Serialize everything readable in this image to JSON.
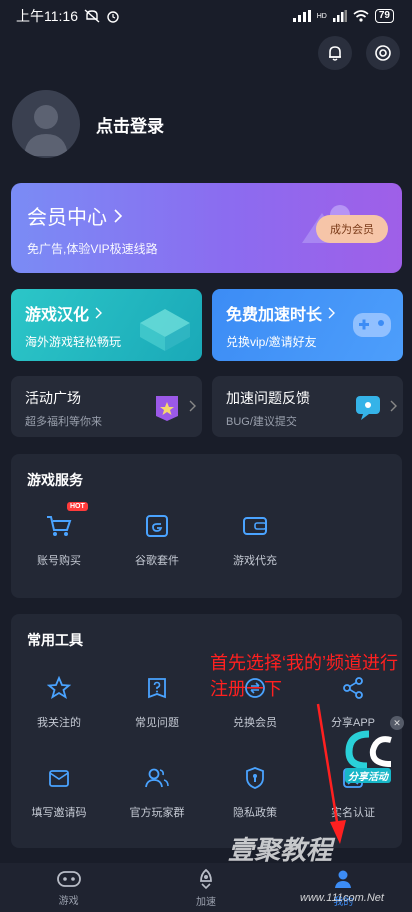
{
  "status": {
    "time": "上午11:16",
    "signal_label": "HD",
    "battery": "79"
  },
  "profile": {
    "login": "点击登录"
  },
  "vip": {
    "title": "会员中心",
    "subtitle": "免广告,体验VIP极速线路",
    "button": "成为会员"
  },
  "promo": [
    {
      "title": "游戏汉化",
      "subtitle": "海外游戏轻松畅玩"
    },
    {
      "title": "免费加速时长",
      "subtitle": "兑换vip/邀请好友"
    }
  ],
  "small_cards": [
    {
      "title": "活动广场",
      "subtitle": "超多福利等你来"
    },
    {
      "title": "加速问题反馈",
      "subtitle": "BUG/建议提交"
    }
  ],
  "game_services": {
    "title": "游戏服务",
    "hot_badge": "HOT",
    "items": [
      {
        "label": "账号购买",
        "icon": "cart-icon"
      },
      {
        "label": "谷歌套件",
        "icon": "google-suite-icon"
      },
      {
        "label": "游戏代充",
        "icon": "wallet-icon"
      }
    ]
  },
  "tools": {
    "title": "常用工具",
    "items": [
      {
        "label": "我关注的",
        "icon": "star-icon"
      },
      {
        "label": "常见问题",
        "icon": "question-icon"
      },
      {
        "label": "兑换会员",
        "icon": "exchange-icon"
      },
      {
        "label": "分享APP",
        "icon": "share-icon"
      },
      {
        "label": "填写邀请码",
        "icon": "invite-icon"
      },
      {
        "label": "官方玩家群",
        "icon": "group-icon"
      },
      {
        "label": "隐私政策",
        "icon": "privacy-icon"
      },
      {
        "label": "实名认证",
        "icon": "id-icon"
      }
    ]
  },
  "annotation": "首先选择‘我的’频道进行注册一下",
  "share_badge": "分享活动",
  "nav": [
    {
      "label": "游戏",
      "icon": "gamepad-icon"
    },
    {
      "label": "加速",
      "icon": "rocket-icon"
    },
    {
      "label": "我的",
      "icon": "user-icon"
    }
  ],
  "watermark": {
    "main": "壹聚教程",
    "url": "www.111com.Net"
  },
  "colors": {
    "background": "#191d29",
    "accent": "#3c8cf5",
    "annotation": "#ff2020"
  }
}
